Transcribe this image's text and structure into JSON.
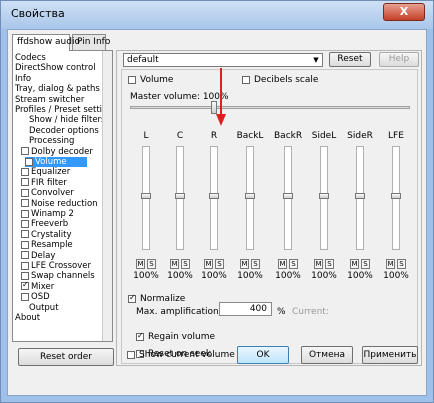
{
  "window": {
    "title": "Свойства",
    "close_label": "X"
  },
  "tabs": [
    {
      "label": "ffdshow audio"
    },
    {
      "label": "Pin Info"
    }
  ],
  "tree": [
    {
      "label": "Codecs",
      "checkbox": false
    },
    {
      "label": "DirectShow control",
      "checkbox": false
    },
    {
      "label": "Info",
      "checkbox": false
    },
    {
      "label": "Tray, dialog & paths",
      "checkbox": false
    },
    {
      "label": "Stream switcher",
      "checkbox": false
    },
    {
      "label": "Profiles / Preset settings",
      "checkbox": false
    },
    {
      "label": "Show / hide filters",
      "checkbox": false
    },
    {
      "label": "Decoder options",
      "checkbox": false
    },
    {
      "label": "Processing",
      "checkbox": false
    },
    {
      "label": "Dolby decoder",
      "checkbox": true,
      "checked": false
    },
    {
      "label": "Volume",
      "checkbox": true,
      "checked": false
    },
    {
      "label": "Equalizer",
      "checkbox": true,
      "checked": false
    },
    {
      "label": "FIR filter",
      "checkbox": true,
      "checked": false
    },
    {
      "label": "Convolver",
      "checkbox": true,
      "checked": false
    },
    {
      "label": "Noise reduction",
      "checkbox": true,
      "checked": false
    },
    {
      "label": "Winamp 2",
      "checkbox": true,
      "checked": false
    },
    {
      "label": "Freeverb",
      "checkbox": true,
      "checked": false
    },
    {
      "label": "Crystality",
      "checkbox": true,
      "checked": false
    },
    {
      "label": "Resample",
      "checkbox": true,
      "checked": false
    },
    {
      "label": "Delay",
      "checkbox": true,
      "checked": false
    },
    {
      "label": "LFE Crossover",
      "checkbox": true,
      "checked": false
    },
    {
      "label": "Swap channels",
      "checkbox": true,
      "checked": false
    },
    {
      "label": "Mixer",
      "checkbox": true,
      "checked": true
    },
    {
      "label": "OSD",
      "checkbox": true,
      "checked": false
    },
    {
      "label": "Output",
      "checkbox": false
    },
    {
      "label": "About",
      "checkbox": false
    }
  ],
  "reset_order_label": "Reset order",
  "preset": {
    "value": "default",
    "reset_label": "Reset",
    "help_label": "Help"
  },
  "volume": {
    "volume_label": "Volume",
    "decibels_label": "Decibels scale",
    "master_label": "Master volume: 100%",
    "master_level": 1.0,
    "channels": [
      {
        "name": "L",
        "pct": "100%",
        "m": "M",
        "s": "S"
      },
      {
        "name": "C",
        "pct": "100%",
        "m": "M",
        "s": "S"
      },
      {
        "name": "R",
        "pct": "100%",
        "m": "M",
        "s": "S"
      },
      {
        "name": "BackL",
        "pct": "100%",
        "m": "M",
        "s": "S"
      },
      {
        "name": "BackR",
        "pct": "100%",
        "m": "M",
        "s": "S"
      },
      {
        "name": "SideL",
        "pct": "100%",
        "m": "M",
        "s": "S"
      },
      {
        "name": "SideR",
        "pct": "100%",
        "m": "M",
        "s": "S"
      },
      {
        "name": "LFE",
        "pct": "100%",
        "m": "M",
        "s": "S"
      }
    ],
    "normalize_label": "Normalize",
    "max_amp_label": "Max. amplification:",
    "max_amp_value": "400",
    "pct_suffix": "%",
    "current_label": "Current:",
    "regain_label": "Regain volume",
    "reset_on_seek_label": "Reset on seek",
    "show_levels_label": "Show current volume levels"
  },
  "buttons": {
    "ok": "OK",
    "cancel": "Отмена",
    "apply": "Применить"
  },
  "colors": {
    "accent": "#3399ff",
    "arrow": "#e02020"
  }
}
